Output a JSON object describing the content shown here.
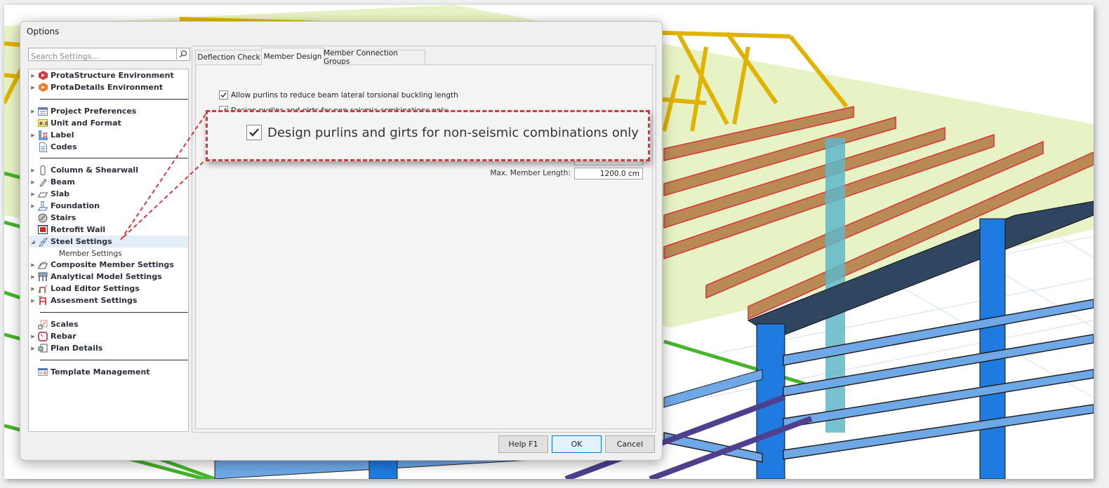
{
  "dialog": {
    "title": "Options",
    "search_placeholder": "Search Settings...",
    "tree": [
      {
        "label": "ProtaStructure Environment",
        "icon": "protastructure-icon",
        "expandable": true
      },
      {
        "label": "ProtaDetails Environment",
        "icon": "protadetails-icon",
        "expandable": true
      },
      {
        "label": "Project Preferences",
        "icon": "project-preferences-icon",
        "expandable": true
      },
      {
        "label": "Unit and Format",
        "icon": "unit-format-icon",
        "expandable": false
      },
      {
        "label": "Label",
        "icon": "label-icon",
        "expandable": true
      },
      {
        "label": "Codes",
        "icon": "codes-icon",
        "expandable": false
      },
      {
        "label": "Column & Shearwall",
        "icon": "column-icon",
        "expandable": true
      },
      {
        "label": "Beam",
        "icon": "beam-icon",
        "expandable": true
      },
      {
        "label": "Slab",
        "icon": "slab-icon",
        "expandable": true
      },
      {
        "label": "Foundation",
        "icon": "foundation-icon",
        "expandable": true
      },
      {
        "label": "Stairs",
        "icon": "stairs-icon",
        "expandable": false
      },
      {
        "label": "Retrofit Wall",
        "icon": "retrofit-wall-icon",
        "expandable": false
      },
      {
        "label": "Steel Settings",
        "icon": "steel-settings-icon",
        "expandable": true,
        "expanded": true,
        "selected": true
      },
      {
        "label": "Member Settings",
        "sub": true
      },
      {
        "label": "Composite Member Settings",
        "icon": "composite-member-icon",
        "expandable": true
      },
      {
        "label": "Analytical Model Settings",
        "icon": "analytical-model-icon",
        "expandable": true
      },
      {
        "label": "Load Editor Settings",
        "icon": "load-editor-icon",
        "expandable": true
      },
      {
        "label": "Assesment Settings",
        "icon": "assessment-icon",
        "expandable": true
      },
      {
        "label": "Scales",
        "icon": "scales-icon",
        "expandable": false
      },
      {
        "label": "Rebar",
        "icon": "rebar-icon",
        "expandable": true
      },
      {
        "label": "Plan Details",
        "icon": "plan-details-icon",
        "expandable": true
      },
      {
        "label": "Template Management",
        "icon": "template-management-icon",
        "expandable": false
      }
    ],
    "tabs": [
      {
        "label": "Deflection Check",
        "active": false
      },
      {
        "label": "Member Design",
        "active": true
      },
      {
        "label": "Member Connection Groups",
        "active": false
      }
    ],
    "options": {
      "allow_purlins_label": "Allow purlins to reduce beam lateral torsional buckling length",
      "allow_purlins_checked": true,
      "design_purlins_label": "Design purlins and girts for non-seismic combinations only",
      "design_purlins_checked": true,
      "max_member_length_label": "Max. Member Length:",
      "max_member_length_value": "1200.0 cm"
    },
    "buttons": {
      "help": "Help  F1",
      "ok": "OK",
      "cancel": "Cancel"
    }
  },
  "callout": {
    "text": "Design purlins and girts for non-seismic combinations only",
    "checked": true,
    "color": "#d33a3a"
  },
  "colors": {
    "truss": "#e6b800",
    "purlin": "#b98a55",
    "steel_column": "#1f7be0",
    "beam_light": "#6fa8e6",
    "slab_green": "#dff0b0",
    "selection": "#e3eef9"
  }
}
